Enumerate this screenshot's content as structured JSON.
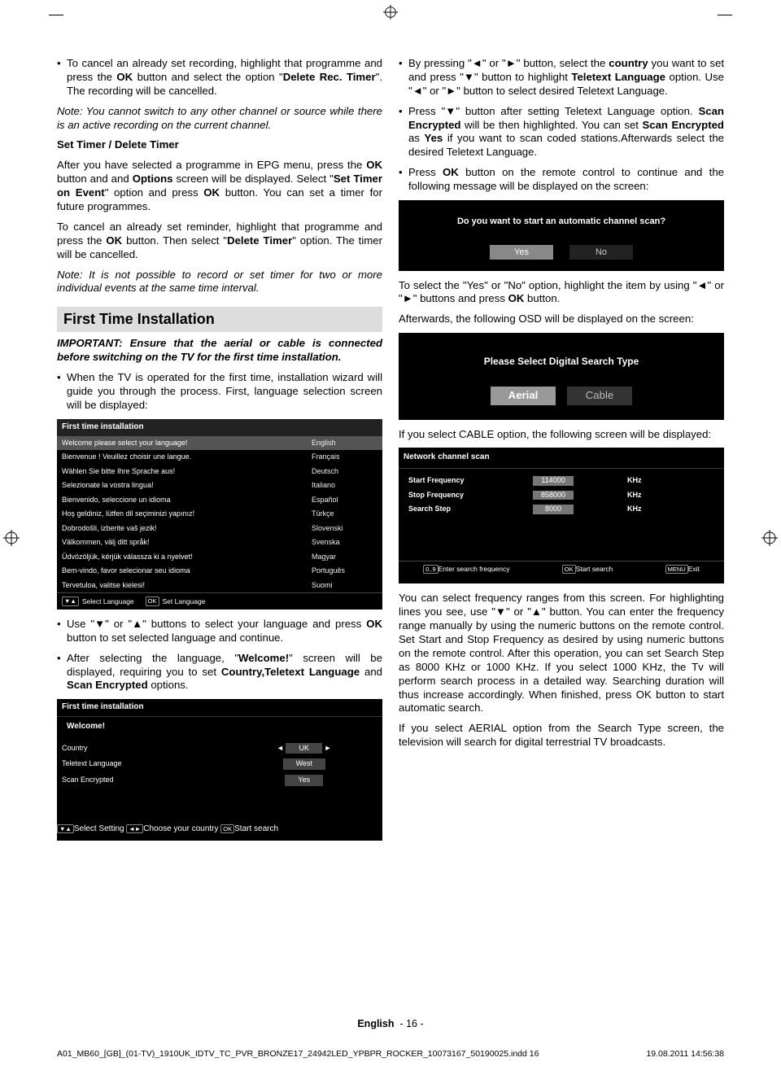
{
  "left_col": {
    "bullet1_a": "To cancel an already set recording, highlight that programme and press the ",
    "bullet1_b": "OK",
    "bullet1_c": " button and select the option \"",
    "bullet1_d": "Delete Rec. Timer",
    "bullet1_e": "\". The recording will be cancelled.",
    "note1": "Note: You cannot switch to any other channel or source while there is an active recording on the current channel.",
    "subhead1": "Set Timer / Delete Timer",
    "para1_a": "After you have selected a programme in EPG menu, press the ",
    "para1_b": "OK",
    "para1_c": " button and and ",
    "para1_d": "Options",
    "para1_e": " screen will be displayed. Select \"",
    "para1_f": "Set Timer on Event",
    "para1_g": "\" option and press ",
    "para1_h": "OK",
    "para1_i": " button. You can set a timer for future programmes.",
    "para2_a": "To cancel an already set reminder, highlight that programme and press the ",
    "para2_b": "OK",
    "para2_c": " button. Then select \"",
    "para2_d": "Delete Timer",
    "para2_e": "\" option. The timer will be cancelled.",
    "note2": "Note: It is not possible to record or set timer for two or more individual events at the same time interval.",
    "section_title": "First Time Installation",
    "important": "IMPORTANT: Ensure that the aerial or cable is connected before switching on the TV for the first time installation.",
    "bullet2": "When the TV is operated for the first time, installation wizard will guide you through the process. First, language selection screen will be displayed:",
    "osd1": {
      "title": "First time installation",
      "rows": [
        [
          "Welcome please select your language!",
          "English"
        ],
        [
          "Bienvenue ! Veuillez choisir une langue.",
          "Français"
        ],
        [
          "Wählen Sie bitte Ihre Sprache aus!",
          "Deutsch"
        ],
        [
          "Selezionate la vostra lingua!",
          "Italiano"
        ],
        [
          "Bienvenido, seleccione un idioma",
          "Español"
        ],
        [
          "Hoş geldiniz, lütfen dil seçiminizi yapınız!",
          "Türkçe"
        ],
        [
          "Dobrodošli, izberite vaš jezik!",
          "Slovenski"
        ],
        [
          "Välkommen, välj ditt språk!",
          "Svenska"
        ],
        [
          "Üdvözöljük, kérjük válassza ki a nyelvet!",
          "Magyar"
        ],
        [
          "Bem-vindo, favor selecionar seu idioma",
          "Português"
        ],
        [
          "Tervetuloa, valitse kielesi!",
          "Suomi"
        ]
      ],
      "hint1": "Select Language",
      "hint1_key": "▼▲",
      "hint2": "Set Language",
      "hint2_key": "OK"
    },
    "bullet3_a": "Use \"",
    "bullet3_b": "\" or \"",
    "bullet3_c": "\" buttons to select your language and press ",
    "bullet3_d": "OK",
    "bullet3_e": " button to set selected language and continue.",
    "bullet4_a": "After selecting the language, \"",
    "bullet4_b": "Welcome!",
    "bullet4_c": "\" screen will be displayed, requiring you to set ",
    "bullet4_d": "Country,Teletext Language",
    "bullet4_e": " and ",
    "bullet4_f": "Scan Encrypted",
    "bullet4_g": " options.",
    "osd2": {
      "title": "First time installation",
      "sub": "Welcome!",
      "rows": [
        [
          "Country",
          "UK",
          true
        ],
        [
          "Teletext Language",
          "West",
          false
        ],
        [
          "Scan Encrypted",
          "Yes",
          false
        ]
      ],
      "hint1": "Select Setting",
      "hint1_key": "▼▲",
      "hint2": "Choose your country",
      "hint2_key": "◄►",
      "hint3": "Start search",
      "hint3_key": "OK"
    }
  },
  "right_col": {
    "bullet1_a": "By pressing \"",
    "bullet1_b": "\" or \"",
    "bullet1_c": "\" button, select the ",
    "bullet1_d": "country",
    "bullet1_e": " you want to set and press \"",
    "bullet1_f": "\" button to highlight ",
    "bullet1_g": "Teletext Language",
    "bullet1_h": " option. Use \"",
    "bullet1_i": "\" or \"",
    "bullet1_j": "\" button to select desired Teletext Language.",
    "bullet2_a": "Press \"",
    "bullet2_b": "\" button after setting Teletext Language option. ",
    "bullet2_c": "Scan Encrypted",
    "bullet2_d": " will be then highlighted. You can set ",
    "bullet2_e": "Scan Encrypted",
    "bullet2_f": " as ",
    "bullet2_g": "Yes",
    "bullet2_h": " if you want to scan coded stations.Afterwards select the desired Teletext Language.",
    "bullet3_a": "Press ",
    "bullet3_b": "OK",
    "bullet3_c": " button on the remote control to continue and the following message will be displayed on the screen:",
    "dialog": {
      "q": "Do you want to start an automatic channel scan?",
      "yes": "Yes",
      "no": "No"
    },
    "para1_a": "To select the \"Yes\" or \"No\" option, highlight the item by using \"",
    "para1_b": "\" or \"",
    "para1_c": "\" buttons and press ",
    "para1_d": "OK",
    "para1_e": " button.",
    "para2": "Afterwards, the following OSD will be displayed on the screen:",
    "searchtype": {
      "label": "Please Select Digital Search Type",
      "aerial": "Aerial",
      "cable": "Cable"
    },
    "para3": "If you select CABLE option, the following screen will be displayed:",
    "netscan": {
      "title": "Network channel scan",
      "rows": [
        [
          "Start Frequency",
          "114000",
          "KHz"
        ],
        [
          "Stop Frequency",
          "858000",
          "KHz"
        ],
        [
          "Search Step",
          "8000",
          "KHz"
        ]
      ],
      "hint1": "Enter search frequency",
      "hint1_key": "0..9",
      "hint2": "Start search",
      "hint2_key": "OK",
      "hint3": "Exit",
      "hint3_key": "MENU"
    },
    "para4_a": "You can select frequency ranges from this screen. For highlighting lines you see, use \"",
    "para4_b": "\" or \"",
    "para4_c": "\" button. You can enter the frequency range manually by using the numeric buttons on the remote control. Set Start and Stop Frequency as desired by using numeric buttons on the remote control. After this operation, you can set Search Step as 8000 KHz or 1000 KHz. If you select 1000 KHz, the Tv will perform search process in a detailed way. Searching duration will thus increase accordingly. When finished, press OK button to start automatic search.",
    "para5": "If you select AERIAL option from the Search Type screen, the television will search for digital terrestrial TV broadcasts."
  },
  "footer": {
    "lang": "English",
    "page": "- 16 -"
  },
  "indd": {
    "file": "A01_MB60_[GB]_(01-TV)_1910UK_IDTV_TC_PVR_BRONZE17_24942LED_YPBPR_ROCKER_10073167_50190025.indd   16",
    "date": "19.08.2011   14:56:38"
  },
  "glyphs": {
    "left": "◄",
    "right": "►",
    "up": "▲",
    "down": "▼"
  }
}
